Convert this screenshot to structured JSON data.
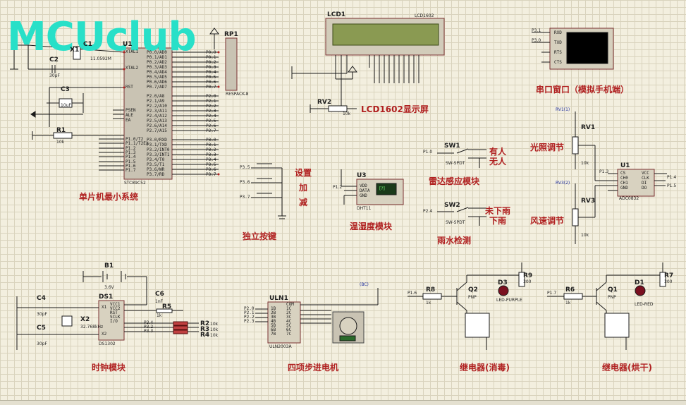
{
  "watermark": "MCUclub",
  "titles": {
    "mcu": "单片机最小系统",
    "keys": "独立按键",
    "key_set": "设置",
    "key_add": "加",
    "key_sub": "减",
    "lcd": "LCD1602显示屏",
    "radar": "雷达感应模块",
    "radar_on": "有人",
    "radar_off": "无人",
    "rain": "雨水检测",
    "rain_on": "未下雨",
    "rain_off": "下雨",
    "serial": "串口窗口（模拟手机端）",
    "light": "光照调节",
    "wind": "风速调节",
    "temp": "温湿度模块",
    "clock": "时钟模块",
    "stepper": "四项步进电机",
    "relay1": "继电器(消毒)",
    "relay2": "继电器(烘干)"
  },
  "refs": {
    "lcd1": "LCD1",
    "lcd1602": "LCD1602",
    "rp1": "RP1",
    "respack": "RESPACK-8",
    "rv2": "RV2",
    "rv2_val": "10k",
    "u1mcu": "U1",
    "mcu_part": "STC89C52",
    "x1": "X1",
    "x1_val": "11.0592M",
    "c1": "C1",
    "c2": "C2",
    "c2_val": "30pF",
    "c3": "C3",
    "c3_val": "10uF",
    "r1": "R1",
    "r1_val": "10k",
    "sw1": "SW1",
    "sw2": "SW2",
    "swspdt": "SW-SPDT",
    "p10": "P1.0",
    "p24": "P2.4",
    "u3": "U3",
    "dht": "DHT11",
    "p12": "P1.2",
    "rv1": "RV1",
    "rv1_v": "RV1(1)",
    "rv3": "RV3",
    "rv3_v": "RV3(2)",
    "u1adc": "U1",
    "adc_part": "ADC0832",
    "p13": "P1.3",
    "p14": "P1.4",
    "p15": "P1.5",
    "p31": "P3.1",
    "p30": "P3.0",
    "b1": "B1",
    "b1_val": "3.6V",
    "c4": "C4",
    "c5": "C5",
    "c6": "C6",
    "c6_val": "1nF",
    "x2": "X2",
    "x2_val": "32.768kHz",
    "ds1": "DS1",
    "ds_part": "DS1302",
    "r5": "R5",
    "r5_val": "1k",
    "r2": "R2",
    "r3": "R3",
    "r4": "R4",
    "p34": "P3.4",
    "p32": "P3.2",
    "p33": "P3.3",
    "uln1": "ULN1",
    "uln_part": "ULN2003A",
    "p16": "P1.6",
    "p17": "P1.7",
    "r8": "R8",
    "r6": "R6",
    "q2": "Q2",
    "q1": "Q1",
    "pnp": "PNP",
    "d3": "D3",
    "d1": "D1",
    "led_purple": "LED-PURPLE",
    "led_red": "LED-RED",
    "r9": "R9",
    "r7": "R7",
    "v300": "300",
    "v1k": "1k",
    "v10k": "10k",
    "bc": "(BC)"
  },
  "mcu_left_pins": [
    "XTAL1",
    "XTAL2",
    "RST",
    "PSEN",
    "ALE",
    "EA",
    "P1.0/T2",
    "P1.1/T2EX",
    "P1.2",
    "P1.3",
    "P1.4",
    "P1.5",
    "P1.6",
    "P1.7"
  ],
  "mcu_right_pins": [
    "P0.0/AD0",
    "P0.1/AD1",
    "P0.2/AD2",
    "P0.3/AD3",
    "P0.4/AD4",
    "P0.5/AD5",
    "P0.6/AD6",
    "P0.7/AD7",
    "P2.0/A8",
    "P2.1/A9",
    "P2.2/A10",
    "P2.3/A11",
    "P2.4/A12",
    "P2.5/A13",
    "P2.6/A14",
    "P2.7/A15",
    "P3.0/RXD",
    "P3.1/TXD",
    "P3.2/INT0",
    "P3.3/INT1",
    "P3.4/T0",
    "P3.5/T1",
    "P3.6/WR",
    "P3.7/RD"
  ],
  "mcu_right_nets": [
    "P0.0",
    "P0.1",
    "P0.2",
    "P0.3",
    "P0.4",
    "P0.5",
    "P0.6",
    "P0.7",
    "P2.0",
    "P2.1",
    "P2.2",
    "P2.3",
    "P2.4",
    "P2.5",
    "P2.6",
    "P2.7",
    "P3.0",
    "P3.1",
    "P3.2",
    "P3.3",
    "P3.4",
    "P3.5",
    "P3.6",
    "P3.7"
  ],
  "key_nets": [
    "P3.5",
    "P3.6",
    "P3.7"
  ],
  "serial_pins": [
    "RXD",
    "TXD",
    "RTS",
    "CTS"
  ],
  "dht_pins": [
    "VDD",
    "DATA",
    "GND"
  ],
  "adc_left": [
    "CS",
    "CH0",
    "CH1",
    "GND"
  ],
  "adc_right": [
    "VCC",
    "CLK",
    "DI",
    "DO"
  ],
  "ds_left": [
    "X1",
    "X2"
  ],
  "ds_right": [
    "VCC1",
    "VCC2",
    "RST",
    "SCLK",
    "I/O"
  ],
  "uln_left": [
    "1B",
    "2B",
    "3B",
    "4B",
    "5B",
    "6B",
    "7B"
  ],
  "uln_right": [
    "COM",
    "1C",
    "2C",
    "3C",
    "4C",
    "5C",
    "6C",
    "7C"
  ],
  "uln_nets": [
    "P2.0",
    "P2.1",
    "P2.2",
    "P2.3"
  ],
  "dht_display": "[?]"
}
